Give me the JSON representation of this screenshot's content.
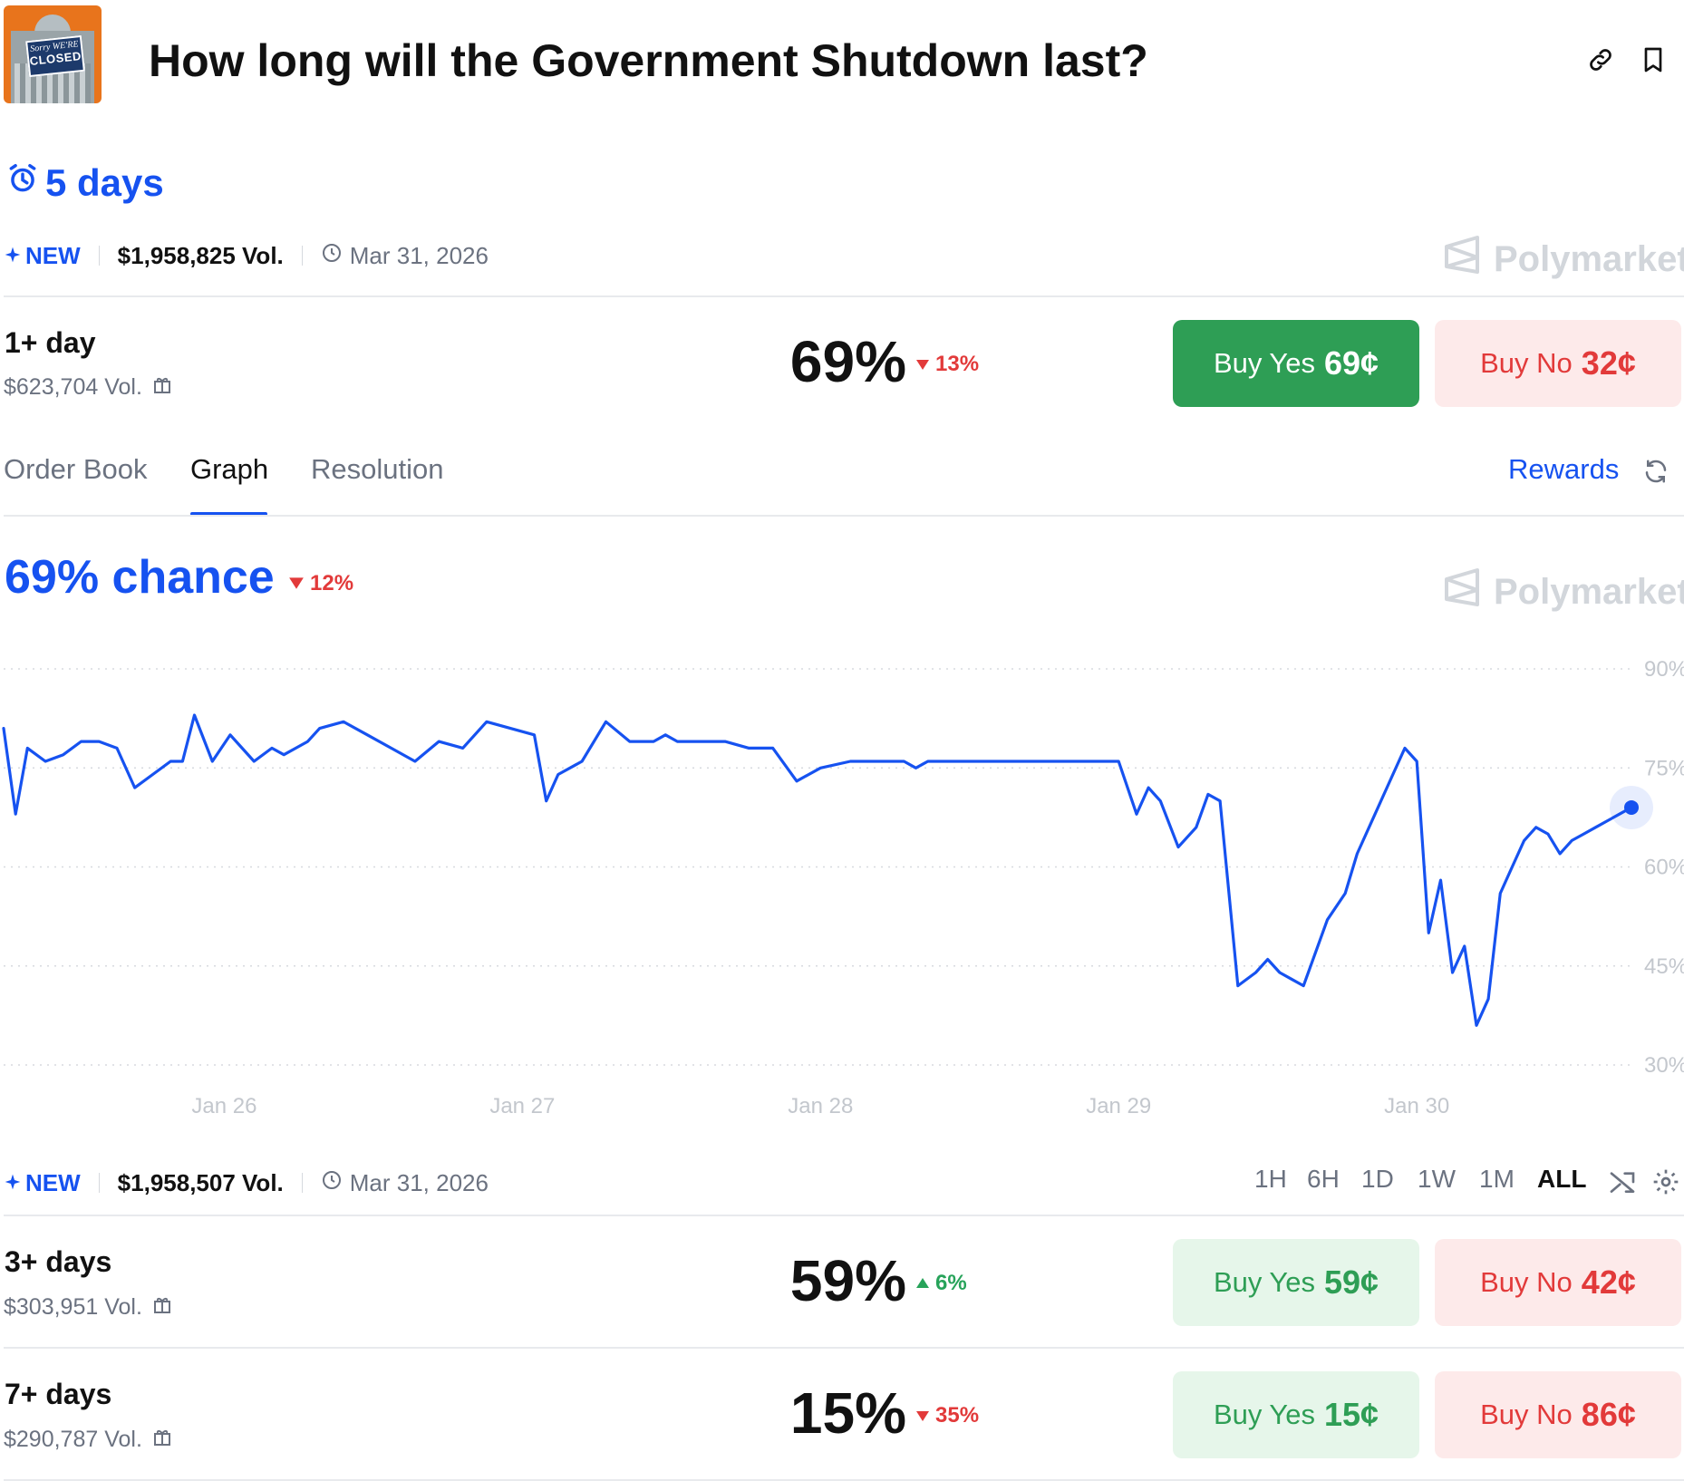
{
  "header": {
    "thumbnail_sign_line1": "Sorry WE'RE",
    "thumbnail_sign_line2": "CLOSED",
    "title": "How long will the Government Shutdown last?",
    "link_icon": "link-icon",
    "bookmark_icon": "bookmark-icon"
  },
  "countdown": {
    "icon": "alarm-clock-icon",
    "label": "5 days"
  },
  "meta_top": {
    "new_label": "NEW",
    "volume": "$1,958,825 Vol.",
    "date": "Mar 31, 2026"
  },
  "brand": {
    "name": "Polymarket"
  },
  "outcomes": [
    {
      "label": "1+ day",
      "volume": "$623,704 Vol.",
      "percent": "69%",
      "change": "13%",
      "direction": "down",
      "buy_yes_label": "Buy Yes",
      "buy_yes_price": "69¢",
      "buy_no_label": "Buy No",
      "buy_no_price": "32¢"
    },
    {
      "label": "3+ days",
      "volume": "$303,951 Vol.",
      "percent": "59%",
      "change": "6%",
      "direction": "up",
      "buy_yes_label": "Buy Yes",
      "buy_yes_price": "59¢",
      "buy_no_label": "Buy No",
      "buy_no_price": "42¢"
    },
    {
      "label": "7+ days",
      "volume": "$290,787 Vol.",
      "percent": "15%",
      "change": "35%",
      "direction": "down",
      "buy_yes_label": "Buy Yes",
      "buy_yes_price": "15¢",
      "buy_no_label": "Buy No",
      "buy_no_price": "86¢"
    }
  ],
  "tabs": {
    "items": [
      "Order Book",
      "Graph",
      "Resolution"
    ],
    "active": "Graph",
    "rewards_label": "Rewards"
  },
  "graph_header": {
    "chance_label": "69% chance",
    "change": "12%",
    "direction": "down"
  },
  "meta_bottom": {
    "new_label": "NEW",
    "volume": "$1,958,507 Vol.",
    "date": "Mar 31, 2026"
  },
  "time_ranges": {
    "items": [
      "1H",
      "6H",
      "1D",
      "1W",
      "1M",
      "ALL"
    ],
    "active": "ALL"
  },
  "colors": {
    "accent": "#1652f0",
    "up": "#27a35a",
    "down": "#e23a3a",
    "yes_button": "#2e9e55"
  },
  "chart_data": {
    "type": "line",
    "title": "",
    "xlabel": "",
    "ylabel": "",
    "x_ticks": [
      "Jan 26",
      "Jan 27",
      "Jan 28",
      "Jan 29",
      "Jan 30"
    ],
    "y_ticks": [
      "90%",
      "75%",
      "60%",
      "45%",
      "30%"
    ],
    "ylim": [
      30,
      90
    ],
    "xlim": [
      25.26,
      30.72
    ],
    "grid": true,
    "series": [
      {
        "x": [
          25.26,
          25.3,
          25.34,
          25.4,
          25.46,
          25.52,
          25.58,
          25.64,
          25.7,
          25.76,
          25.82,
          25.86,
          25.9,
          25.96,
          26.02,
          26.1,
          26.16,
          26.2,
          26.24,
          26.28,
          26.32,
          26.4,
          26.48,
          26.56,
          26.64,
          26.72,
          26.8,
          26.88,
          26.96,
          27.04,
          27.08,
          27.12,
          27.2,
          27.28,
          27.36,
          27.44,
          27.48,
          27.52,
          27.6,
          27.68,
          27.76,
          27.84,
          27.92,
          28.0,
          28.1,
          28.2,
          28.28,
          28.32,
          28.36,
          28.44,
          28.52,
          28.6,
          28.7,
          28.8,
          28.9,
          29.0,
          29.06,
          29.1,
          29.14,
          29.2,
          29.26,
          29.3,
          29.34,
          29.4,
          29.46,
          29.5,
          29.54,
          29.58,
          29.62,
          29.7,
          29.76,
          29.8,
          29.86,
          29.92,
          29.96,
          30.0,
          30.04,
          30.08,
          30.12,
          30.16,
          30.2,
          30.24,
          30.28,
          30.32,
          30.36,
          30.4,
          30.44,
          30.48,
          30.52,
          30.56,
          30.6,
          30.64,
          30.68,
          30.72
        ],
        "y": [
          81,
          68,
          78,
          76,
          77,
          79,
          79,
          78,
          72,
          74,
          76,
          76,
          83,
          76,
          80,
          76,
          78,
          77,
          78,
          79,
          81,
          82,
          80,
          78,
          76,
          79,
          78,
          82,
          81,
          80,
          70,
          74,
          76,
          82,
          79,
          79,
          80,
          79,
          79,
          79,
          78,
          78,
          73,
          75,
          76,
          76,
          76,
          75,
          76,
          76,
          76,
          76,
          76,
          76,
          76,
          76,
          68,
          72,
          70,
          63,
          66,
          71,
          70,
          42,
          44,
          46,
          44,
          43,
          42,
          52,
          56,
          62,
          68,
          74,
          78,
          76,
          50,
          58,
          44,
          48,
          36,
          40,
          56,
          60,
          64,
          66,
          65,
          62,
          64,
          65,
          66,
          67,
          68,
          69
        ]
      }
    ]
  }
}
